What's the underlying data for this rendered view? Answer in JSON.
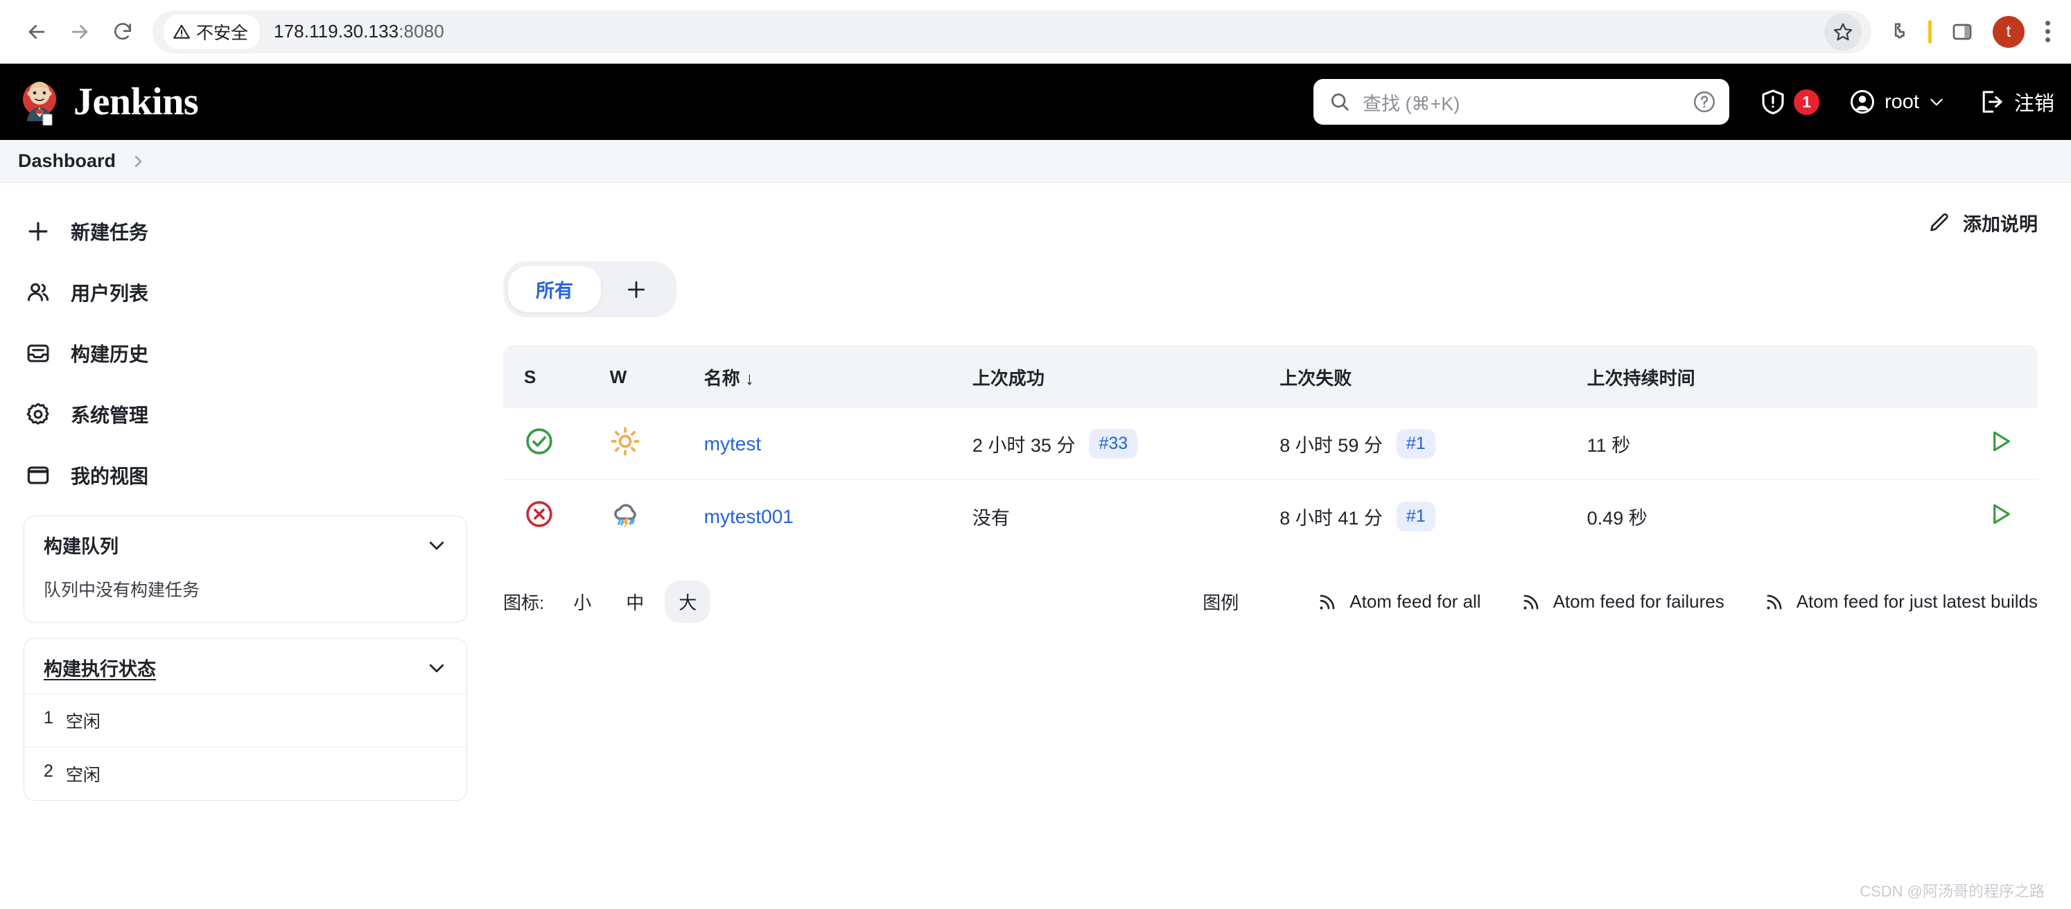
{
  "browser": {
    "back_icon": "back-arrow-icon",
    "forward_icon": "forward-arrow-icon",
    "reload_icon": "reload-icon",
    "security_label": "不安全",
    "url_host": "178.119.30.133",
    "url_port": ":8080",
    "star_icon": "bookmark-star-icon",
    "extensions_icon": "extensions-puzzle-icon",
    "split_icon": "side-panel-icon",
    "profile_initial": "t",
    "menu_icon": "three-dot-menu-icon"
  },
  "header": {
    "title": "Jenkins",
    "search_placeholder": "查找 (⌘+K)",
    "help_icon": "question-circle-icon",
    "security_badge": "1",
    "user": "root",
    "logout": "注销"
  },
  "breadcrumb": {
    "items": [
      "Dashboard"
    ]
  },
  "sidebar": {
    "items": [
      {
        "label": "新建任务",
        "icon": "plus-icon"
      },
      {
        "label": "用户列表",
        "icon": "people-icon"
      },
      {
        "label": "构建历史",
        "icon": "inbox-icon"
      },
      {
        "label": "系统管理",
        "icon": "gear-icon"
      },
      {
        "label": "我的视图",
        "icon": "window-icon"
      }
    ],
    "build_queue": {
      "title": "构建队列",
      "empty_text": "队列中没有构建任务"
    },
    "executor_status": {
      "title": "构建执行状态",
      "rows": [
        {
          "num": "1",
          "state": "空闲"
        },
        {
          "num": "2",
          "state": "空闲"
        }
      ]
    }
  },
  "main": {
    "add_description": "添加说明",
    "tabs": {
      "selected": "所有",
      "add_icon": "plus-icon"
    },
    "table": {
      "headers": [
        "S",
        "W",
        "名称 ↓",
        "上次成功",
        "上次失败",
        "上次持续时间"
      ],
      "rows": [
        {
          "status": "success",
          "weather": "sunny",
          "name": "mytest",
          "last_success": "2 小时 35 分",
          "last_success_build": "#33",
          "last_failure": "8 小时 59 分",
          "last_failure_build": "#1",
          "duration": "11 秒",
          "run_icon": "play-triangle-icon"
        },
        {
          "status": "failed",
          "weather": "stormy",
          "name": "mytest001",
          "last_success": "没有",
          "last_success_build": "",
          "last_failure": "8 小时 41 分",
          "last_failure_build": "#1",
          "duration": "0.49 秒",
          "run_icon": "play-triangle-icon"
        }
      ]
    },
    "footer": {
      "icon_label": "图标:",
      "sizes": [
        "小",
        "中",
        "大"
      ],
      "active_size": "大",
      "legend": "图例",
      "feeds": [
        "Atom feed for all",
        "Atom feed for failures",
        "Atom feed for just latest builds"
      ]
    }
  },
  "watermark": "CSDN @阿汤哥的程序之路"
}
